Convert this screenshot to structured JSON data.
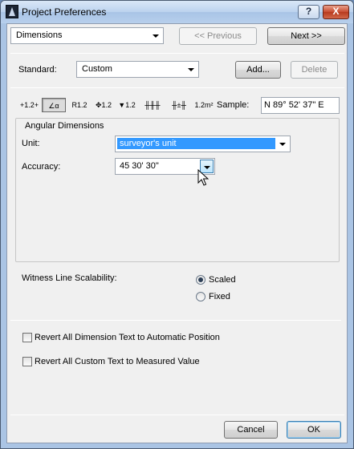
{
  "window": {
    "title": "Project Preferences",
    "help_label": "?",
    "close_label": "X"
  },
  "nav": {
    "category_select": "Dimensions",
    "previous_label": "<< Previous",
    "next_label": "Next >>"
  },
  "standard": {
    "label": "Standard:",
    "value": "Custom",
    "add_label": "Add...",
    "delete_label": "Delete"
  },
  "toolbar": {
    "tools": [
      {
        "name": "linear-dimension-tool",
        "label": "+1.2+"
      },
      {
        "name": "angular-dimension-tool",
        "label": "∠α"
      },
      {
        "name": "radial-dimension-tool",
        "label": "R1.2"
      },
      {
        "name": "level-dimension-tool",
        "label": "✥1.2"
      },
      {
        "name": "elevation-dimension-tool",
        "label": "▼1.2"
      },
      {
        "name": "door-window-dimension-tool",
        "label": "╫╫╫"
      },
      {
        "name": "sill-height-dimension-tool",
        "label": "╫±╫"
      },
      {
        "name": "area-dimension-tool",
        "label": "1.2m²"
      }
    ],
    "selected_index": 1,
    "sample_label": "Sample:",
    "sample_value": "N 89° 52' 37\" E"
  },
  "angular": {
    "group_title": "Angular Dimensions",
    "unit_label": "Unit:",
    "unit_value": "surveyor's unit",
    "accuracy_label": "Accuracy:",
    "accuracy_value": "45 30' 30\""
  },
  "witness": {
    "label": "Witness Line Scalability:",
    "options": [
      {
        "label": "Scaled",
        "checked": true
      },
      {
        "label": "Fixed",
        "checked": false
      }
    ]
  },
  "reverts": {
    "revert_dimension_text": "Revert All Dimension Text to Automatic Position",
    "revert_custom_text": "Revert All Custom Text to Measured Value"
  },
  "footer": {
    "cancel_label": "Cancel",
    "ok_label": "OK"
  },
  "colors": {
    "selection": "#3399ff",
    "dialog_bg": "#f0f0f0",
    "title_bar": "#bcd3ee"
  }
}
